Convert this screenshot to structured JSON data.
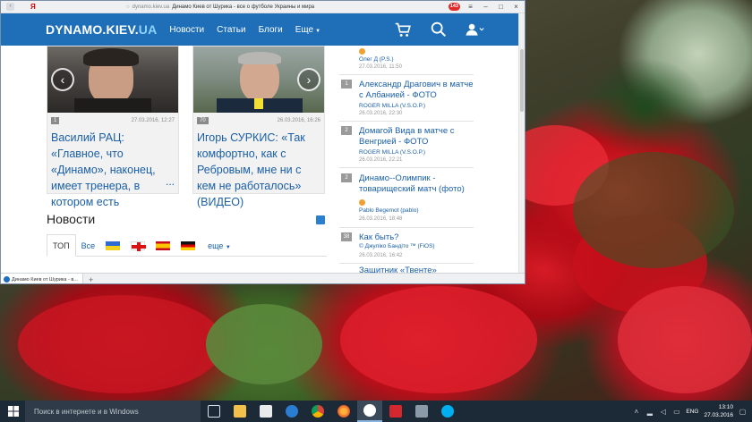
{
  "browser": {
    "url_host": "dynamo.kiev.ua",
    "page_title": "Динамо Киев от Шурика - все о футболе Украины и мира",
    "ya_logo": "Я",
    "badge": "143",
    "back_icon": "back-arrow-icon",
    "tab_label": "Динамо Киев от Шурика - в...",
    "new_tab": "+"
  },
  "site": {
    "logo_main": "DYNAMO.KIEV.",
    "logo_suffix": "UA",
    "nav": [
      "Новости",
      "Статьи",
      "Блоги",
      "Еще"
    ],
    "cards": [
      {
        "count": "1",
        "date": "27.03.2016, 12:27",
        "headline": "Василий РАЦ: «Главное, что «Динамо», наконец, имеет тренера, в котором есть",
        "ellipsis": "..."
      },
      {
        "count": "70",
        "date": "26.03.2016, 16:26",
        "headline": "Игорь СУРКИС: «Так комфортно, как с Ребровым, мне ни с кем не работалось» (ВИДЕО)"
      }
    ],
    "news_heading": "Новости",
    "tabs": {
      "top": "ТОП",
      "all": "Все",
      "more": "еще"
    }
  },
  "sidebar": {
    "items": [
      {
        "count": "",
        "title": "",
        "author": "Олег Д (P.S.)",
        "date": "27.03.2016, 11:50"
      },
      {
        "count": "1",
        "title": "Александр Драгович в матче с Албанией - ФОТО",
        "author": "ROGER MILLA (V.S.O.P.)",
        "date": "26.03.2016, 22:30"
      },
      {
        "count": "2",
        "title": "Домагой Вида в матче с Венгрией - ФОТО",
        "author": "ROGER MILLA (V.S.O.P.)",
        "date": "26.03.2016, 22:21"
      },
      {
        "count": "2",
        "title": "Динамо--Олимпик - товарищеский матч (фото)",
        "author": "Pablo Begemot (pablo)",
        "date": "26.03.2016, 18:48"
      },
      {
        "count": "38",
        "title": "Как быть?",
        "author": "© Джуліко Бандіто ™ (FiOS)",
        "date": "26.03.2016, 16:42"
      },
      {
        "count": "",
        "title": "Защитник «Твенте»",
        "author": "",
        "date": ""
      }
    ]
  },
  "taskbar": {
    "search_placeholder": "Поиск в интернете и в Windows",
    "lang": "ENG",
    "time": "13:10",
    "date": "27.03.2016"
  }
}
